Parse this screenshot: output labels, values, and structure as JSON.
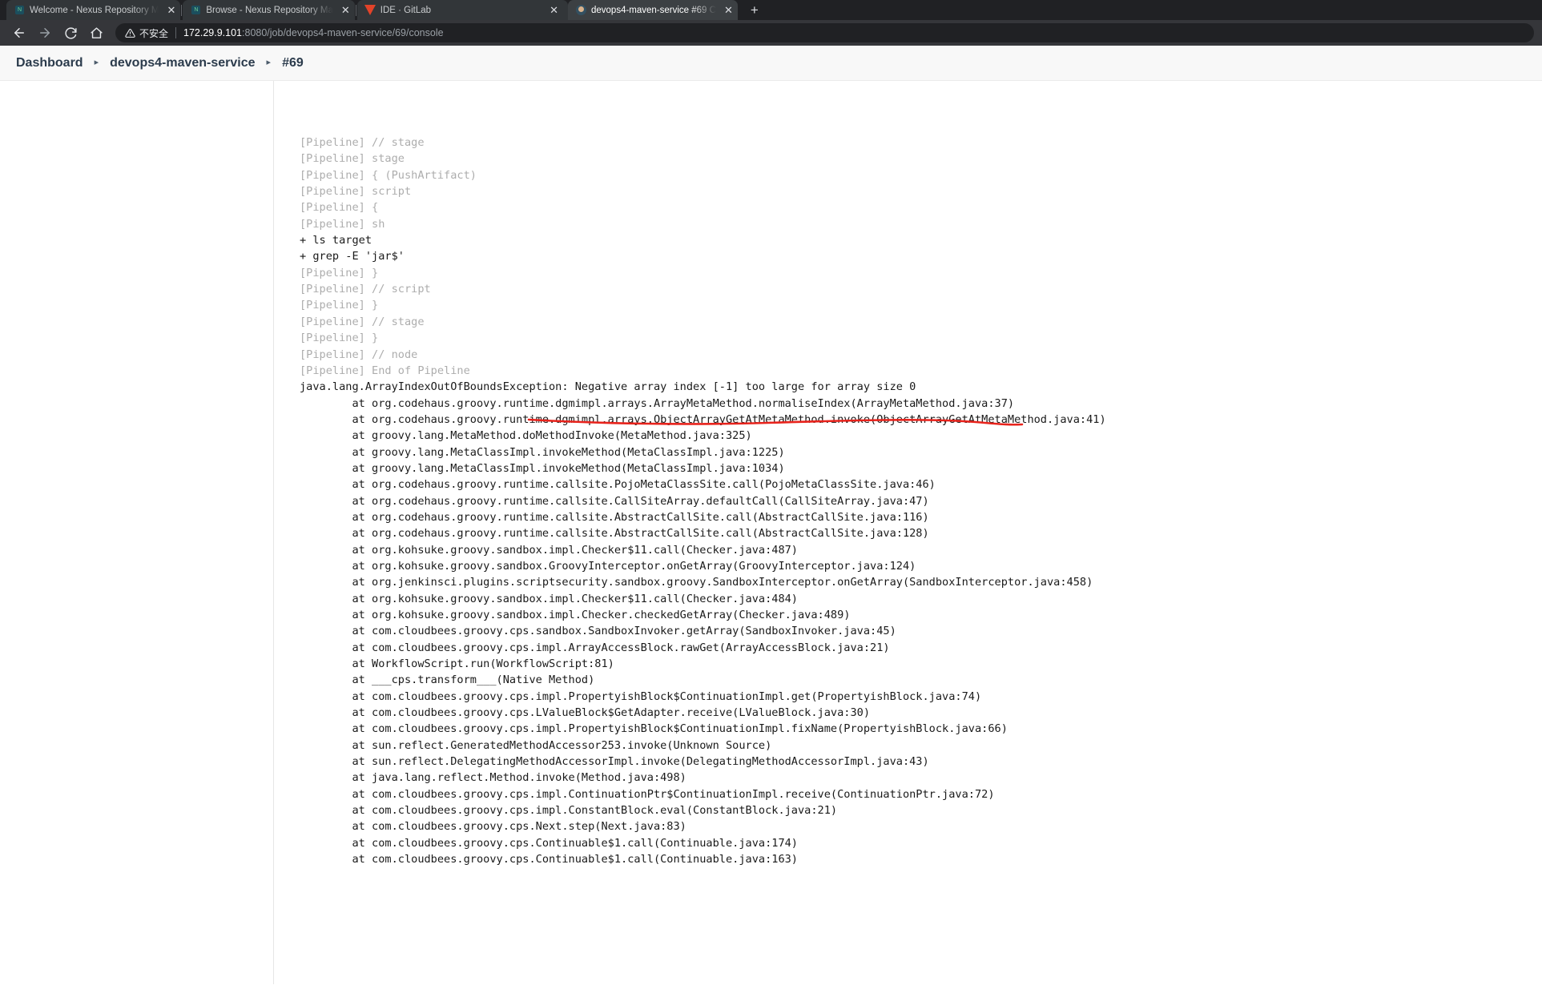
{
  "browser": {
    "tabs": [
      {
        "title": "Welcome - Nexus Repository M",
        "favicon": "nexus-icon",
        "close_label": "✕",
        "active": false
      },
      {
        "title": "Browse - Nexus Repository Ma",
        "favicon": "nexus-icon",
        "close_label": "✕",
        "active": false
      },
      {
        "title": "IDE · GitLab",
        "favicon": "gitlab-icon",
        "close_label": "✕",
        "active": false
      },
      {
        "title": "devops4-maven-service #69 C",
        "favicon": "jenkins-icon",
        "close_label": "✕",
        "active": true
      }
    ],
    "new_tab_label": "+",
    "nav": {
      "back_label": "←",
      "forward_label": "→",
      "reload_label": "↻",
      "home_label": "⌂"
    },
    "omnibox": {
      "security_text": "不安全",
      "url_host": "172.29.9.101",
      "url_rest": ":8080/job/devops4-maven-service/69/console"
    }
  },
  "breadcrumb": {
    "separator": "▸",
    "items": [
      "Dashboard",
      "devops4-maven-service",
      "#69"
    ]
  },
  "annotation": {
    "color": "#e8231c",
    "target_text": "Negative array index [-1] too large for array size 0"
  },
  "console": {
    "lines": [
      {
        "text": "[Pipeline] // stage",
        "kind": "pipeline"
      },
      {
        "text": "[Pipeline] stage",
        "kind": "pipeline"
      },
      {
        "text": "[Pipeline] { (PushArtifact)",
        "kind": "pipeline"
      },
      {
        "text": "[Pipeline] script",
        "kind": "pipeline"
      },
      {
        "text": "[Pipeline] {",
        "kind": "pipeline"
      },
      {
        "text": "[Pipeline] sh",
        "kind": "pipeline"
      },
      {
        "text": "+ ls target",
        "kind": "cmd"
      },
      {
        "text": "+ grep -E 'jar$'",
        "kind": "cmd"
      },
      {
        "text": "[Pipeline] }",
        "kind": "pipeline"
      },
      {
        "text": "[Pipeline] // script",
        "kind": "pipeline"
      },
      {
        "text": "[Pipeline] }",
        "kind": "pipeline"
      },
      {
        "text": "[Pipeline] // stage",
        "kind": "pipeline"
      },
      {
        "text": "[Pipeline] }",
        "kind": "pipeline"
      },
      {
        "text": "[Pipeline] // node",
        "kind": "pipeline"
      },
      {
        "text": "[Pipeline] End of Pipeline",
        "kind": "pipeline"
      },
      {
        "text": "java.lang.ArrayIndexOutOfBoundsException: Negative array index [-1] too large for array size 0",
        "kind": "err"
      },
      {
        "text": "        at org.codehaus.groovy.runtime.dgmimpl.arrays.ArrayMetaMethod.normaliseIndex(ArrayMetaMethod.java:37)",
        "kind": "trace"
      },
      {
        "text": "        at org.codehaus.groovy.runtime.dgmimpl.arrays.ObjectArrayGetAtMetaMethod.invoke(ObjectArrayGetAtMetaMethod.java:41)",
        "kind": "trace"
      },
      {
        "text": "        at groovy.lang.MetaMethod.doMethodInvoke(MetaMethod.java:325)",
        "kind": "trace"
      },
      {
        "text": "        at groovy.lang.MetaClassImpl.invokeMethod(MetaClassImpl.java:1225)",
        "kind": "trace"
      },
      {
        "text": "        at groovy.lang.MetaClassImpl.invokeMethod(MetaClassImpl.java:1034)",
        "kind": "trace"
      },
      {
        "text": "        at org.codehaus.groovy.runtime.callsite.PojoMetaClassSite.call(PojoMetaClassSite.java:46)",
        "kind": "trace"
      },
      {
        "text": "        at org.codehaus.groovy.runtime.callsite.CallSiteArray.defaultCall(CallSiteArray.java:47)",
        "kind": "trace"
      },
      {
        "text": "        at org.codehaus.groovy.runtime.callsite.AbstractCallSite.call(AbstractCallSite.java:116)",
        "kind": "trace"
      },
      {
        "text": "        at org.codehaus.groovy.runtime.callsite.AbstractCallSite.call(AbstractCallSite.java:128)",
        "kind": "trace"
      },
      {
        "text": "        at org.kohsuke.groovy.sandbox.impl.Checker$11.call(Checker.java:487)",
        "kind": "trace"
      },
      {
        "text": "        at org.kohsuke.groovy.sandbox.GroovyInterceptor.onGetArray(GroovyInterceptor.java:124)",
        "kind": "trace"
      },
      {
        "text": "        at org.jenkinsci.plugins.scriptsecurity.sandbox.groovy.SandboxInterceptor.onGetArray(SandboxInterceptor.java:458)",
        "kind": "trace"
      },
      {
        "text": "        at org.kohsuke.groovy.sandbox.impl.Checker$11.call(Checker.java:484)",
        "kind": "trace"
      },
      {
        "text": "        at org.kohsuke.groovy.sandbox.impl.Checker.checkedGetArray(Checker.java:489)",
        "kind": "trace"
      },
      {
        "text": "        at com.cloudbees.groovy.cps.sandbox.SandboxInvoker.getArray(SandboxInvoker.java:45)",
        "kind": "trace"
      },
      {
        "text": "        at com.cloudbees.groovy.cps.impl.ArrayAccessBlock.rawGet(ArrayAccessBlock.java:21)",
        "kind": "trace"
      },
      {
        "text": "        at WorkflowScript.run(WorkflowScript:81)",
        "kind": "trace"
      },
      {
        "text": "        at ___cps.transform___(Native Method)",
        "kind": "trace"
      },
      {
        "text": "        at com.cloudbees.groovy.cps.impl.PropertyishBlock$ContinuationImpl.get(PropertyishBlock.java:74)",
        "kind": "trace"
      },
      {
        "text": "        at com.cloudbees.groovy.cps.LValueBlock$GetAdapter.receive(LValueBlock.java:30)",
        "kind": "trace"
      },
      {
        "text": "        at com.cloudbees.groovy.cps.impl.PropertyishBlock$ContinuationImpl.fixName(PropertyishBlock.java:66)",
        "kind": "trace"
      },
      {
        "text": "        at sun.reflect.GeneratedMethodAccessor253.invoke(Unknown Source)",
        "kind": "trace"
      },
      {
        "text": "        at sun.reflect.DelegatingMethodAccessorImpl.invoke(DelegatingMethodAccessorImpl.java:43)",
        "kind": "trace"
      },
      {
        "text": "        at java.lang.reflect.Method.invoke(Method.java:498)",
        "kind": "trace"
      },
      {
        "text": "        at com.cloudbees.groovy.cps.impl.ContinuationPtr$ContinuationImpl.receive(ContinuationPtr.java:72)",
        "kind": "trace"
      },
      {
        "text": "        at com.cloudbees.groovy.cps.impl.ConstantBlock.eval(ConstantBlock.java:21)",
        "kind": "trace"
      },
      {
        "text": "        at com.cloudbees.groovy.cps.Next.step(Next.java:83)",
        "kind": "trace"
      },
      {
        "text": "        at com.cloudbees.groovy.cps.Continuable$1.call(Continuable.java:174)",
        "kind": "trace"
      },
      {
        "text": "        at com.cloudbees.groovy.cps.Continuable$1.call(Continuable.java:163)",
        "kind": "trace"
      }
    ]
  }
}
